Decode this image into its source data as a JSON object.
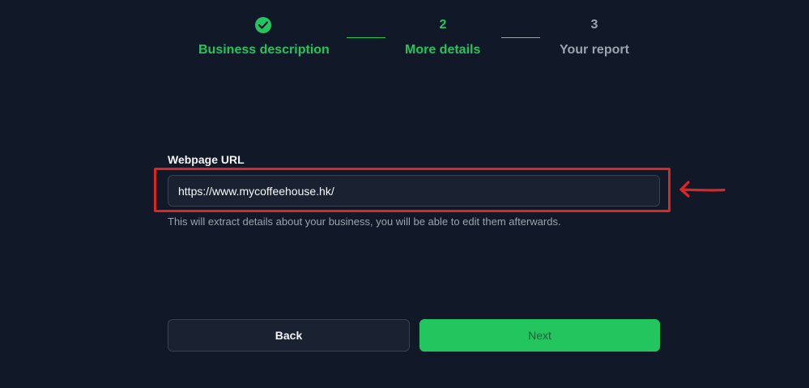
{
  "stepper": {
    "steps": [
      {
        "marker": "",
        "label": "Business description",
        "state": "complete",
        "icon": "check-circle-icon"
      },
      {
        "marker": "2",
        "label": "More details",
        "state": "active"
      },
      {
        "marker": "3",
        "label": "Your report",
        "state": "upcoming"
      }
    ]
  },
  "form": {
    "url_label": "Webpage URL",
    "url_value": "https://www.mycoffeehouse.hk/",
    "helper_text": "This will extract details about your business, you will be able to edit them afterwards."
  },
  "annotation": {
    "highlight_color": "#dc2626",
    "arrow_icon": "left-arrow-icon"
  },
  "buttons": {
    "back_label": "Back",
    "next_label": "Next"
  },
  "colors": {
    "background": "#111827",
    "accent": "#22c55e",
    "muted": "#9ca3af"
  }
}
